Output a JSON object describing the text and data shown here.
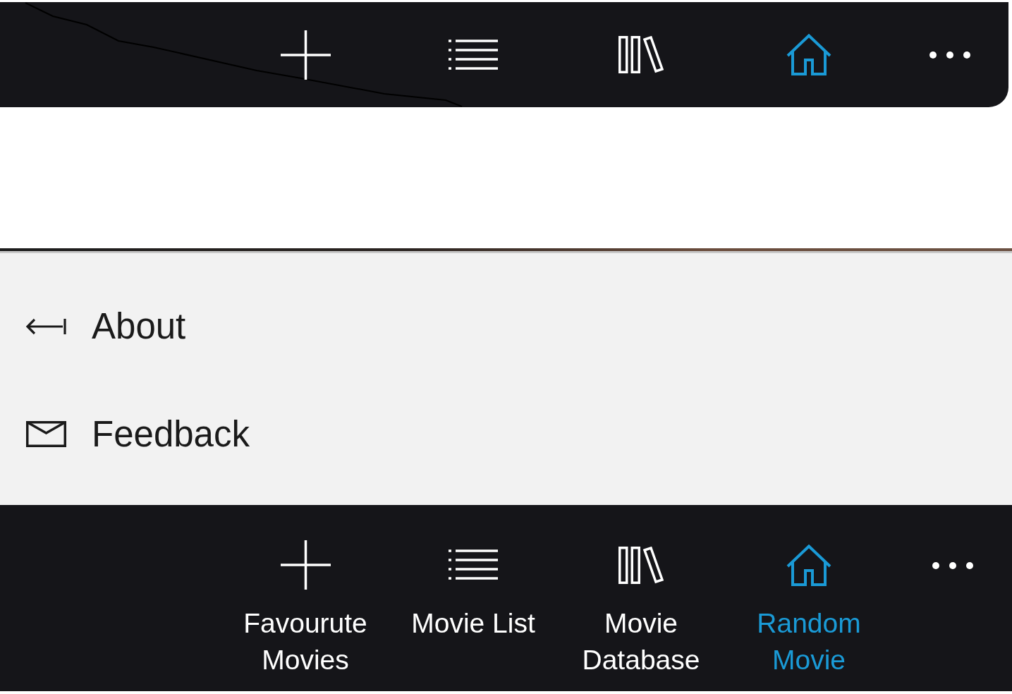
{
  "compact_bar": {
    "buttons": [
      {
        "selected": false
      },
      {
        "selected": false
      },
      {
        "selected": false
      },
      {
        "selected": true
      }
    ]
  },
  "menu": {
    "items": [
      {
        "label": "About"
      },
      {
        "label": "Feedback"
      }
    ]
  },
  "command_bar": {
    "buttons": [
      {
        "label": "Favourute Movies",
        "selected": false
      },
      {
        "label": "Movie List",
        "selected": false
      },
      {
        "label": "Movie Database",
        "selected": false
      },
      {
        "label": "Random Movie",
        "selected": true
      }
    ]
  }
}
